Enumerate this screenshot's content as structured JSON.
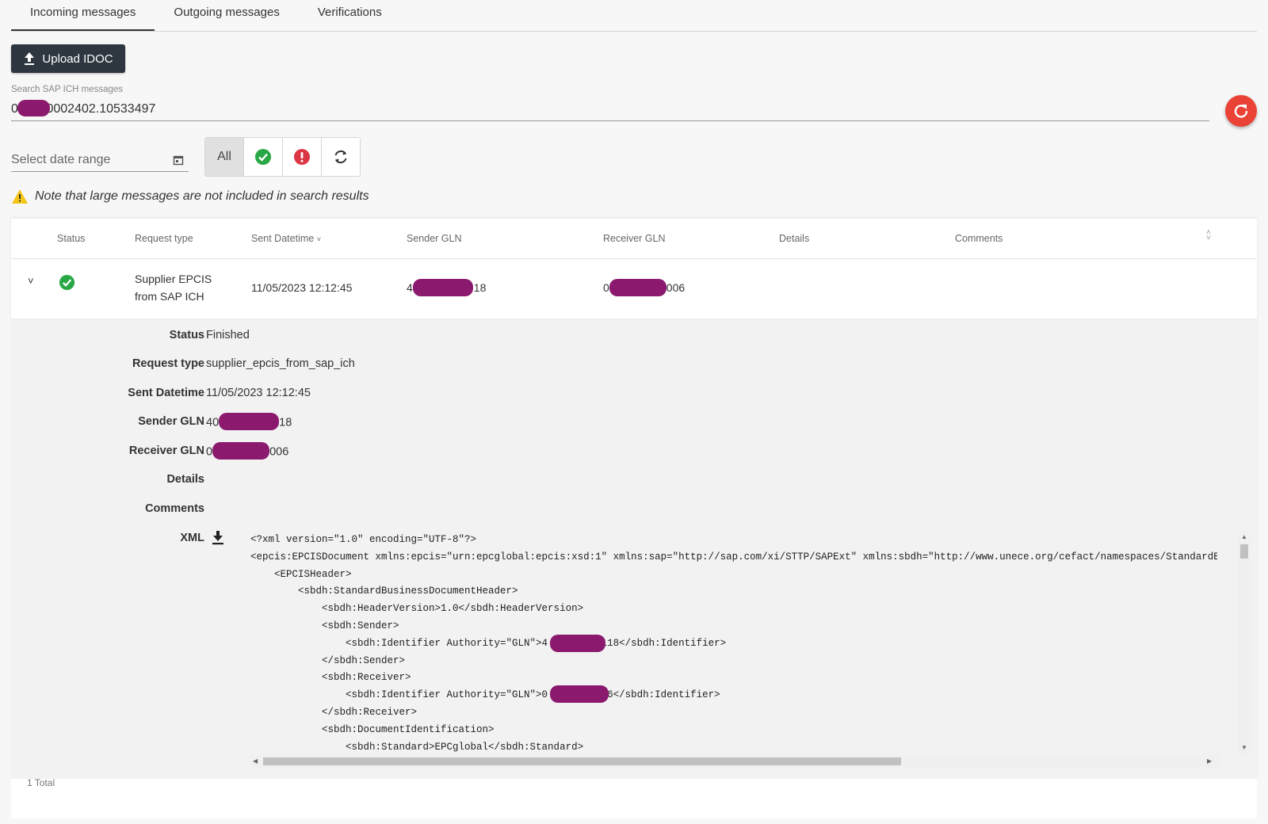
{
  "tabs": [
    "Incoming messages",
    "Outgoing messages",
    "Verifications"
  ],
  "upload_label": "Upload IDOC",
  "search": {
    "label": "Search SAP ICH messages",
    "value": "0     7.0002402.10533497"
  },
  "date_range_placeholder": "Select date range",
  "filters": {
    "all_label": "All"
  },
  "note": "Note that large messages are not included in search results",
  "table": {
    "headers": {
      "status": "Status",
      "request_type": "Request type",
      "sent_datetime": "Sent Datetime",
      "sender_gln": "Sender GLN",
      "receiver_gln": "Receiver GLN",
      "details": "Details",
      "comments": "Comments"
    },
    "row": {
      "request_type_line1": "Supplier EPCIS",
      "request_type_line2": "from SAP ICH",
      "sent_datetime": "11/05/2023 12:12:45",
      "sender_gln_start": "4",
      "sender_gln_end": "18",
      "receiver_gln_start": "0",
      "receiver_gln_end": "006"
    }
  },
  "detail": {
    "labels": {
      "status": "Status",
      "request_type": "Request type",
      "sent_datetime": "Sent Datetime",
      "sender_gln": "Sender GLN",
      "receiver_gln": "Receiver GLN",
      "details": "Details",
      "comments": "Comments",
      "xml": "XML"
    },
    "values": {
      "status": "Finished",
      "request_type": "supplier_epcis_from_sap_ich",
      "sent_datetime": "11/05/2023 12:12:45",
      "sender_gln_start": "40",
      "sender_gln_end": "18",
      "receiver_gln_start": "0",
      "receiver_gln_end": "006"
    },
    "xml_lines": [
      "<?xml version=\"1.0\" encoding=\"UTF-8\"?>",
      "<epcis:EPCISDocument xmlns:epcis=\"urn:epcglobal:epcis:xsd:1\" xmlns:sap=\"http://sap.com/xi/STTP/SAPExt\" xmlns:sbdh=\"http://www.unece.org/cefact/namespaces/StandardBusinessDocumentHeader\"",
      "    <EPCISHeader>",
      "        <sbdh:StandardBusinessDocumentHeader>",
      "            <sbdh:HeaderVersion>1.0</sbdh:HeaderVersion>",
      "            <sbdh:Sender>",
      "                <sbdh:Identifier Authority=\"GLN\">4         118</sbdh:Identifier>",
      "            </sbdh:Sender>",
      "            <sbdh:Receiver>",
      "                <sbdh:Identifier Authority=\"GLN\">0         06</sbdh:Identifier>",
      "            </sbdh:Receiver>",
      "            <sbdh:DocumentIdentification>",
      "                <sbdh:Standard>EPCglobal</sbdh:Standard>"
    ]
  },
  "total": "1 Total",
  "colors": {
    "button_dark": "#2e3740",
    "refresh": "#ea4335",
    "success": "#28a745",
    "error": "#dc3545",
    "warning": "#f5c518",
    "redaction": "#8b1a6e"
  },
  "icons": [
    "upload-icon",
    "refresh-icon",
    "calendar-icon",
    "check-circle-icon",
    "error-circle-icon",
    "sync-icon",
    "warning-icon",
    "sort-icon",
    "chevron-down-icon",
    "download-icon"
  ]
}
